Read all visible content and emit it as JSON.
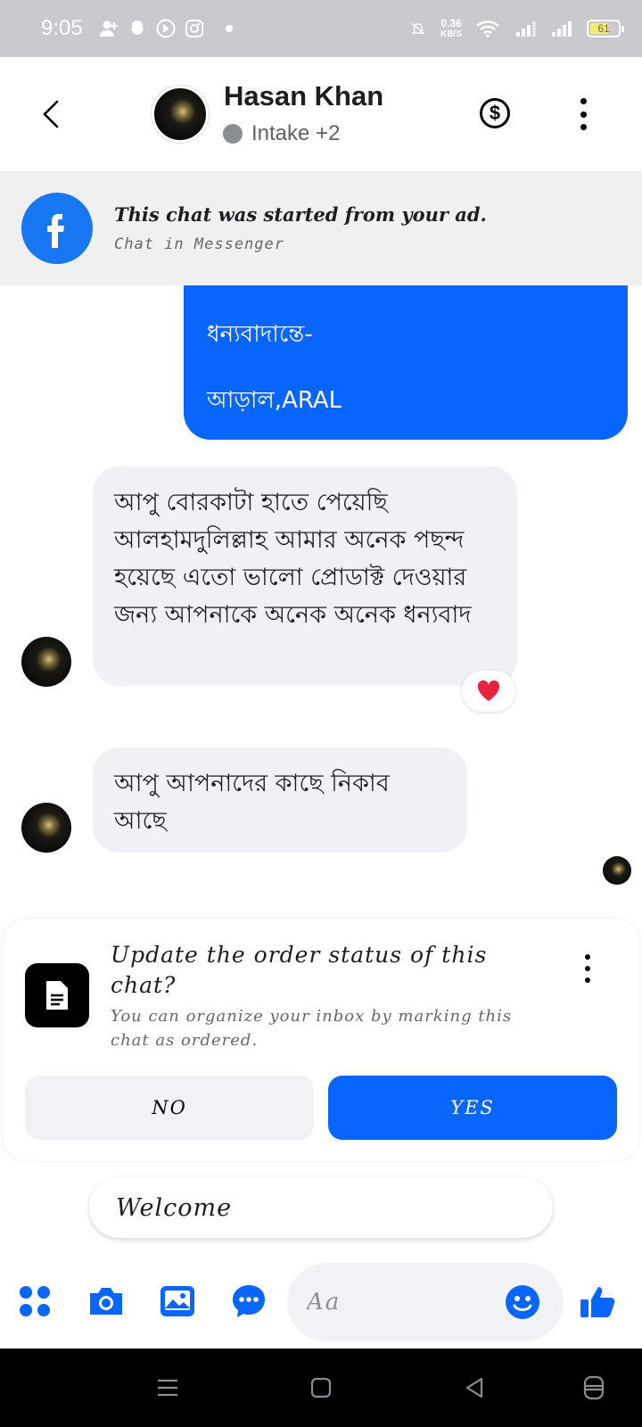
{
  "status_bar": {
    "time": "9:05",
    "net_speed_value": "0.36",
    "net_speed_unit": "KB/S",
    "battery": "61",
    "icons": [
      "add-user-icon",
      "snapchat-icon",
      "play-icon",
      "instagram-icon",
      "dot-icon",
      "mute-icon",
      "wifi-icon",
      "signal-icon",
      "signal-icon",
      "battery-icon"
    ]
  },
  "header": {
    "contact_name": "Hasan Khan",
    "contact_status": "Intake +2"
  },
  "ad_banner": {
    "title": "This chat was started from your ad.",
    "subtitle": "Chat in Messenger"
  },
  "messages": {
    "outgoing_line1": "ধন্যবাদান্তে-",
    "outgoing_line2": "আড়াল,ARAL",
    "incoming_1": "আপু বোরকাটা হাতে পেয়েছি আলহামদুলিল্লাহ আমার অনেক পছন্দ হয়েছে এতো ভালো প্রোডাক্ট দেওয়ার জন্য আপনাকে অনেক অনেক ধন্যবাদ",
    "incoming_2": "আপু আপনাদের কাছে নিকাব আছে",
    "reaction": "❤"
  },
  "order_card": {
    "title": "Update the order status of this chat?",
    "subtitle": "You can organize your inbox by marking this chat as ordered.",
    "no_label": "NO",
    "yes_label": "YES"
  },
  "quick_reply": {
    "label": "Welcome"
  },
  "composer": {
    "placeholder": "Aa",
    "value": ""
  },
  "colors": {
    "accent": "#0866ff",
    "facebook_blue": "#1877f2",
    "bubble_gray": "#f0f1f5"
  }
}
